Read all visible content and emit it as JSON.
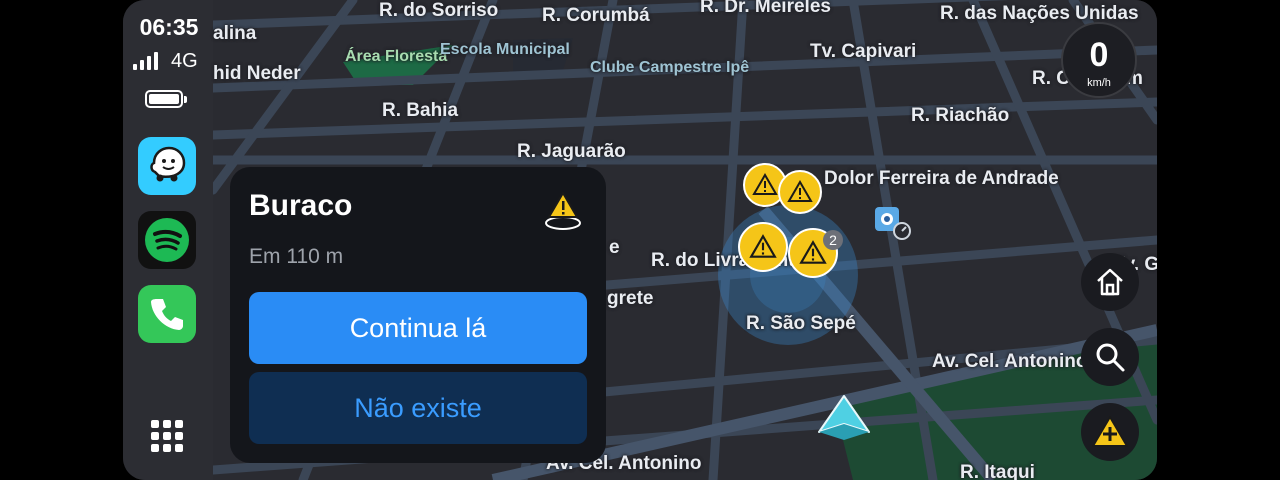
{
  "status": {
    "time": "06:35",
    "network": "4G",
    "battery_level": 1.0
  },
  "dock": {
    "apps": [
      {
        "name": "Waze",
        "color": "#33ccff"
      },
      {
        "name": "Spotify",
        "color": "#1db954"
      },
      {
        "name": "Phone",
        "color": "#34c759"
      }
    ]
  },
  "map": {
    "streets": [
      "R. do Sorriso",
      "R. Corumbá",
      "R. Dr. Meireles",
      "R. das Nações Unidas",
      "alina",
      "hid Neder",
      "Tv. Capivari",
      "R. Bahia",
      "R. Riachão",
      "R. Jaguarão",
      "Dolor Ferreira de Andrade",
      "R. do Livramento",
      "grete",
      "R. São Sepé",
      "Tv. Gua",
      "Av. Cel. Antonino",
      "Av. Cel. Antonino",
      "R. Itaqui",
      "e",
      "R. Cel. Ozim"
    ],
    "pois": [
      "Área Floresta",
      "Escola Municipal",
      "Clube Campestre Ipê"
    ],
    "hazard_cluster_count": "2"
  },
  "speed": {
    "value": "0",
    "unit": "km/h"
  },
  "alert_card": {
    "title": "Buraco",
    "distance": "Em 110 m",
    "confirm_label": "Continua lá",
    "deny_label": "Não existe"
  },
  "colors": {
    "accent": "#2a8cf5",
    "hazard": "#f5c518",
    "map_bg": "#2a2b31"
  }
}
